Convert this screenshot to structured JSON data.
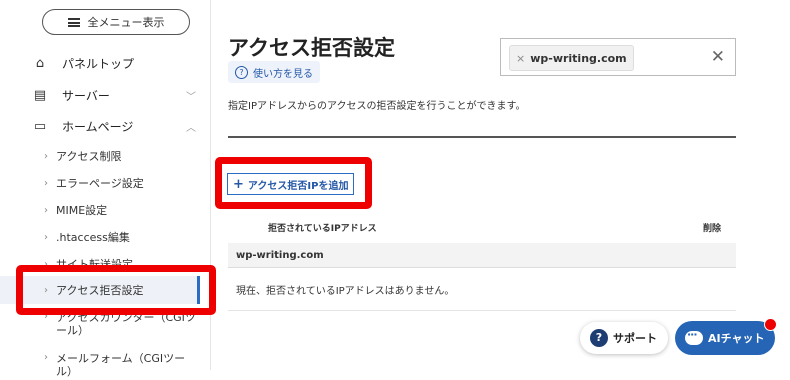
{
  "sidebar": {
    "menu_button": "全メニュー表示",
    "items": [
      {
        "label": "パネルトップ",
        "icon": "home-icon"
      },
      {
        "label": "サーバー",
        "icon": "server-icon"
      },
      {
        "label": "ホームページ",
        "icon": "window-icon"
      }
    ],
    "sub_items": [
      "アクセス制限",
      "エラーページ設定",
      "MIME設定",
      ".htaccess編集",
      "サイト転送設定",
      "アクセス拒否設定",
      "アクセスカウンター（CGIツール）",
      "メールフォーム（CGIツール）"
    ],
    "active_index": 5
  },
  "main": {
    "title": "アクセス拒否設定",
    "help_label": "使い方を見る",
    "domain_chip": "wp-writing.com",
    "description": "指定IPアドレスからのアクセスの拒否設定を行うことができます。",
    "add_button": "アクセス拒否IPを追加",
    "table": {
      "col_ip": "拒否されているIPアドレス",
      "col_delete": "削除",
      "group": "wp-writing.com",
      "empty_message": "現在、拒否されているIPアドレスはありません。"
    }
  },
  "floating": {
    "support_label": "サポート",
    "ai_chat_label": "AIチャット"
  },
  "colors": {
    "highlight": "#ee0000",
    "accent": "#2665b5",
    "link": "#2457a6"
  }
}
